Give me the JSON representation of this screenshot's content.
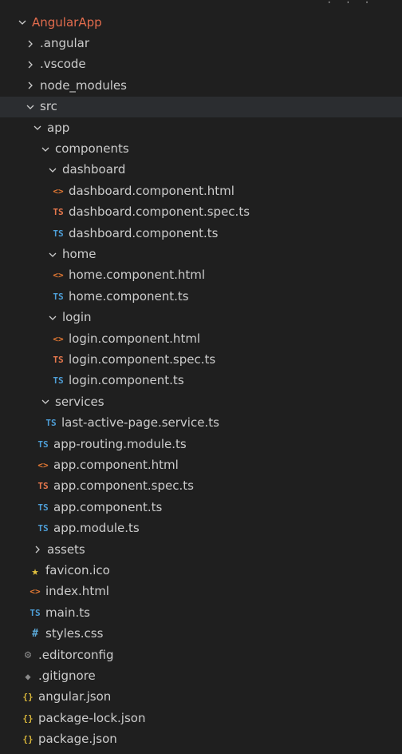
{
  "tree": {
    "root": {
      "label": "AngularApp",
      "expanded": true
    },
    "items": [
      {
        "label": ".angular",
        "type": "folder",
        "expanded": false
      },
      {
        "label": ".vscode",
        "type": "folder",
        "expanded": false
      },
      {
        "label": "node_modules",
        "type": "folder",
        "expanded": false
      },
      {
        "label": "src",
        "type": "folder",
        "expanded": true
      },
      {
        "label": "app",
        "type": "folder",
        "expanded": true
      },
      {
        "label": "components",
        "type": "folder",
        "expanded": true
      },
      {
        "label": "dashboard",
        "type": "folder",
        "expanded": true
      },
      {
        "label": "dashboard.component.html",
        "type": "html",
        "icon_text": "<>"
      },
      {
        "label": "dashboard.component.spec.ts",
        "type": "spec",
        "icon_text": "TS"
      },
      {
        "label": "dashboard.component.ts",
        "type": "ts",
        "icon_text": "TS"
      },
      {
        "label": "home",
        "type": "folder",
        "expanded": true
      },
      {
        "label": "home.component.html",
        "type": "html",
        "icon_text": "<>"
      },
      {
        "label": "home.component.ts",
        "type": "ts",
        "icon_text": "TS"
      },
      {
        "label": "login",
        "type": "folder",
        "expanded": true
      },
      {
        "label": "login.component.html",
        "type": "html",
        "icon_text": "<>"
      },
      {
        "label": "login.component.spec.ts",
        "type": "spec",
        "icon_text": "TS"
      },
      {
        "label": "login.component.ts",
        "type": "ts",
        "icon_text": "TS"
      },
      {
        "label": "services",
        "type": "folder",
        "expanded": true
      },
      {
        "label": "last-active-page.service.ts",
        "type": "ts",
        "icon_text": "TS"
      },
      {
        "label": "app-routing.module.ts",
        "type": "ts",
        "icon_text": "TS"
      },
      {
        "label": "app.component.html",
        "type": "html",
        "icon_text": "<>"
      },
      {
        "label": "app.component.spec.ts",
        "type": "spec",
        "icon_text": "TS"
      },
      {
        "label": "app.component.ts",
        "type": "ts",
        "icon_text": "TS"
      },
      {
        "label": "app.module.ts",
        "type": "ts",
        "icon_text": "TS"
      },
      {
        "label": "assets",
        "type": "folder",
        "expanded": false
      },
      {
        "label": "favicon.ico",
        "type": "ico",
        "icon_text": "★"
      },
      {
        "label": "index.html",
        "type": "html",
        "icon_text": "<>"
      },
      {
        "label": "main.ts",
        "type": "ts",
        "icon_text": "TS"
      },
      {
        "label": "styles.css",
        "type": "css",
        "icon_text": "#"
      },
      {
        "label": ".editorconfig",
        "type": "config",
        "icon_text": "⚙"
      },
      {
        "label": ".gitignore",
        "type": "git",
        "icon_text": "◆"
      },
      {
        "label": "angular.json",
        "type": "json",
        "icon_text": "{}"
      },
      {
        "label": "package-lock.json",
        "type": "json",
        "icon_text": "{}"
      },
      {
        "label": "package.json",
        "type": "json",
        "icon_text": "{}"
      }
    ]
  },
  "colors": {
    "background": "#1f1f1f",
    "selected_row": "#2b2d30",
    "root_label": "#e36c4d",
    "ts_icon": "#4e9fd8",
    "spec_icon": "#e8784d",
    "html_icon": "#e37933",
    "json_icon": "#d7b53a",
    "css_icon": "#5aa7d6",
    "text": "#cccccc"
  }
}
